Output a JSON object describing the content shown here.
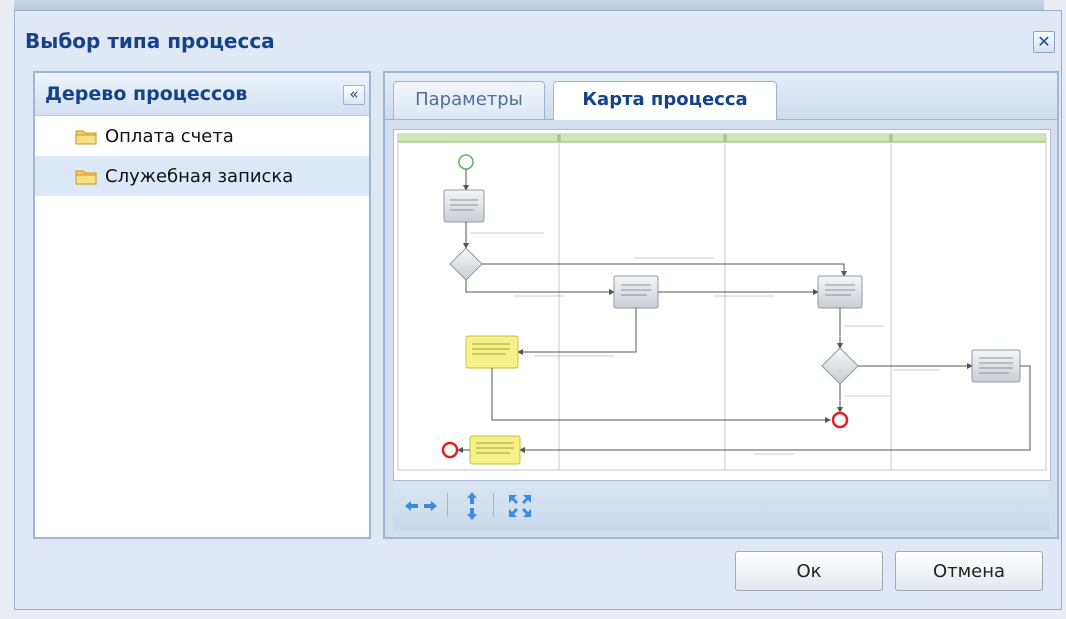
{
  "window": {
    "title": "Выбор типа процесса",
    "close_glyph": "✕"
  },
  "left_panel": {
    "title": "Дерево процессов",
    "collapse_glyph": "«",
    "items": [
      {
        "label": "Оплата счета",
        "icon": "folder-icon",
        "selected": false
      },
      {
        "label": "Служебная записка",
        "icon": "folder-icon",
        "selected": true
      }
    ]
  },
  "right_panel": {
    "tabs": [
      {
        "label": "Параметры",
        "active": false
      },
      {
        "label": "Карта процесса",
        "active": true
      }
    ],
    "toolbar": {
      "pan_horizontal_icon": "arrows-left-right-icon",
      "pan_vertical_icon": "arrows-up-down-icon",
      "fit_icon": "expand-icon"
    }
  },
  "footer": {
    "ok_label": "Ок",
    "cancel_label": "Отмена"
  },
  "colors": {
    "title_blue": "#15428b",
    "panel_border": "#9fb7d6",
    "lane_header": "#cfe8b4",
    "highlight_box": "#f5f08a",
    "end_event": "#e02020"
  }
}
